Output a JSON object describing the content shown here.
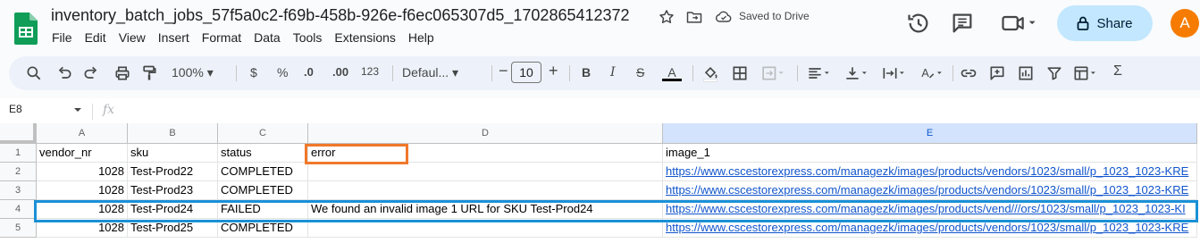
{
  "header": {
    "doc_title": "inventory_batch_jobs_57f5a0c2-f69b-458b-926e-f6ec065307d5_1702865412372",
    "saved_status": "Saved to Drive",
    "share_label": "Share",
    "avatar_letter": "A"
  },
  "menu": [
    "File",
    "Edit",
    "View",
    "Insert",
    "Format",
    "Data",
    "Tools",
    "Extensions",
    "Help"
  ],
  "toolbar": {
    "zoom": "100%",
    "currency": "$",
    "percent": "%",
    "decrease_decimal": ".0",
    "increase_decimal": ".00",
    "number_format": "123",
    "font": "Defaul...",
    "font_size": "10"
  },
  "formula_bar": {
    "cell_ref": "E8",
    "fx_label": "fx",
    "content": ""
  },
  "sheet": {
    "columns": [
      "A",
      "B",
      "C",
      "D",
      "E"
    ],
    "rows": [
      "1",
      "2",
      "3",
      "4",
      "5"
    ],
    "cells": [
      [
        "vendor_nr",
        "sku",
        "status",
        "error",
        "image_1"
      ],
      [
        "1028",
        "Test-Prod22",
        "COMPLETED",
        "",
        "https://www.cscestorexpress.com/managezk/images/products/vendors/1023/small/p_1023_1023-KRE"
      ],
      [
        "1028",
        "Test-Prod23",
        "COMPLETED",
        "",
        "https://www.cscestorexpress.com/managezk/images/products/vendors/1023/small/p_1023_1023-KRE"
      ],
      [
        "1028",
        "Test-Prod24",
        "FAILED",
        "We found an invalid image 1 URL for SKU Test-Prod24",
        "https://www.cscestorexpress.com/managezk/images/products/vend///ors/1023/small/p_1023_1023-KI"
      ],
      [
        "1028",
        "Test-Prod25",
        "COMPLETED",
        "",
        "https://www.cscestorexpress.com/managezk/images/products/vendors/1023/small/p_1023_1023-KRE"
      ]
    ]
  },
  "colors": {
    "share_bg": "#c2e7ff",
    "avatar": "#f57c00",
    "highlight_header": "#f0782a",
    "highlight_row": "#1a90d6",
    "link": "#1155cc"
  }
}
